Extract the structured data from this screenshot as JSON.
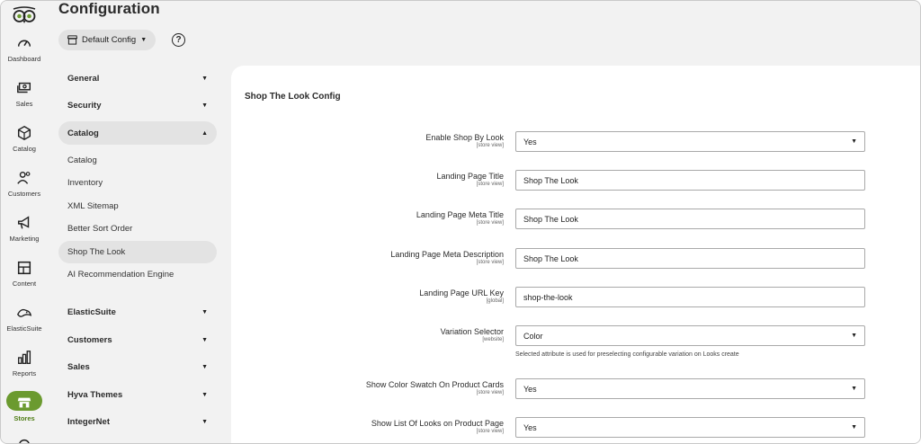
{
  "header": {
    "title": "Configuration",
    "scope_label": "Default Config",
    "help_glyph": "?"
  },
  "rail": {
    "items": [
      {
        "label": "Dashboard",
        "icon": "gauge-icon"
      },
      {
        "label": "Sales",
        "icon": "cash-icon"
      },
      {
        "label": "Catalog",
        "icon": "cube-icon"
      },
      {
        "label": "Customers",
        "icon": "users-icon"
      },
      {
        "label": "Marketing",
        "icon": "megaphone-icon"
      },
      {
        "label": "Content",
        "icon": "layout-icon"
      },
      {
        "label": "ElasticSuite",
        "icon": "elasticsuite-icon"
      },
      {
        "label": "Reports",
        "icon": "bar-chart-icon"
      },
      {
        "label": "Stores",
        "icon": "store-icon"
      }
    ],
    "active_color": "#6b9a2f"
  },
  "nav": {
    "sections_top": [
      {
        "label": "General"
      },
      {
        "label": "Security"
      }
    ],
    "catalog": {
      "label": "Catalog",
      "children": [
        {
          "label": "Catalog"
        },
        {
          "label": "Inventory"
        },
        {
          "label": "XML Sitemap"
        },
        {
          "label": "Better Sort Order"
        },
        {
          "label": "Shop The Look"
        },
        {
          "label": "AI Recommendation Engine"
        }
      ]
    },
    "sections_bottom": [
      {
        "label": "ElasticSuite"
      },
      {
        "label": "Customers"
      },
      {
        "label": "Sales"
      },
      {
        "label": "Hyva Themes"
      },
      {
        "label": "IntegerNet"
      }
    ]
  },
  "main": {
    "title": "Shop The Look Config",
    "fields": [
      {
        "label": "Enable Shop By Look",
        "scope": "[store view]",
        "type": "select",
        "value": "Yes"
      },
      {
        "label": "Landing Page Title",
        "scope": "[store view]",
        "type": "input",
        "value": "Shop The Look"
      },
      {
        "label": "Landing Page Meta Title",
        "scope": "[store view]",
        "type": "input",
        "value": "Shop The Look"
      },
      {
        "label": "Landing Page Meta Description",
        "scope": "[store view]",
        "type": "input",
        "value": "Shop The Look"
      },
      {
        "label": "Landing Page URL Key",
        "scope": "[global]",
        "type": "input",
        "value": "shop-the-look"
      },
      {
        "label": "Variation Selector",
        "scope": "[website]",
        "type": "select",
        "value": "Color",
        "note": "Selected attribute is used for preselecting configurable variation on Looks create"
      },
      {
        "label": "Show Color Swatch On Product Cards",
        "scope": "[store view]",
        "type": "select",
        "value": "Yes"
      },
      {
        "label": "Show List Of Looks on Product Page",
        "scope": "[store view]",
        "type": "select",
        "value": "Yes"
      }
    ]
  }
}
